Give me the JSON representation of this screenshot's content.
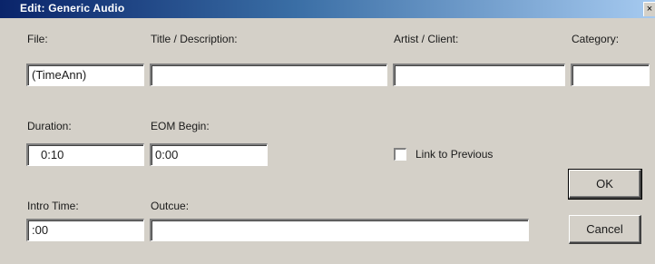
{
  "window": {
    "title": "Edit: Generic Audio",
    "close_glyph": "×"
  },
  "labels": {
    "file": "File:",
    "title_description": "Title / Description:",
    "artist_client": "Artist / Client:",
    "category": "Category:",
    "duration": "Duration:",
    "eom_begin": "EOM Begin:",
    "intro_time": "Intro Time:",
    "outcue": "Outcue:",
    "link_to_previous": "Link to Previous"
  },
  "fields": {
    "file": "(TimeAnn)",
    "title_description": "",
    "artist_client": "",
    "category": "",
    "duration": "0:10",
    "eom_begin": "0:00",
    "intro_time": ":00",
    "outcue": ""
  },
  "checkbox": {
    "link_to_previous_checked": false
  },
  "buttons": {
    "ok": "OK",
    "cancel": "Cancel"
  },
  "colors": {
    "dialog_face": "#d4d0c8",
    "titlebar_start": "#0a246a",
    "titlebar_end": "#a6caf0"
  }
}
